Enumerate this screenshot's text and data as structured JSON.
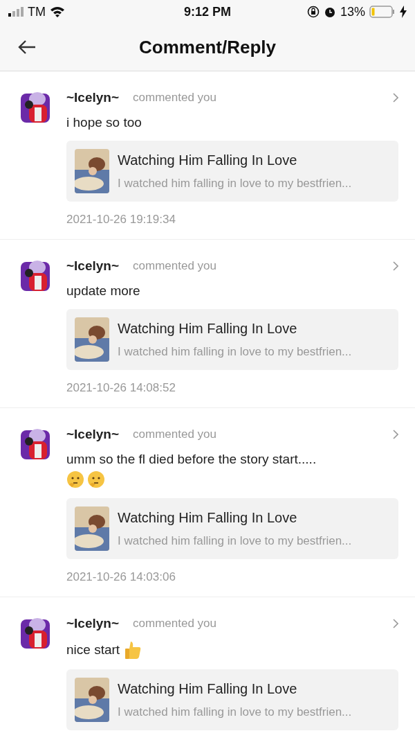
{
  "status_bar": {
    "carrier": "TM",
    "time": "9:12 PM",
    "battery": "13%"
  },
  "header": {
    "title": "Comment/Reply"
  },
  "notifications": [
    {
      "user": "~Icelyn~",
      "action": "commented you",
      "text": "i hope so too",
      "story": {
        "title": "Watching Him Falling In Love",
        "excerpt": "I watched him falling in love to my bestfrien..."
      },
      "date": "2021-10-26 19:19:34"
    },
    {
      "user": "~Icelyn~",
      "action": "commented you",
      "text": "update more",
      "story": {
        "title": "Watching Him Falling In Love",
        "excerpt": "I watched him falling in love to my bestfrien..."
      },
      "date": "2021-10-26 14:08:52"
    },
    {
      "user": "~Icelyn~",
      "action": "commented you",
      "text": "umm so the fl died before the story start.....",
      "emoji_line": [
        {
          "kind": "thinking"
        },
        {
          "kind": "thinking"
        }
      ],
      "story": {
        "title": "Watching Him Falling In Love",
        "excerpt": "I watched him falling in love to my bestfrien..."
      },
      "date": "2021-10-26 14:03:06"
    },
    {
      "user": "~Icelyn~",
      "action": "commented you",
      "text": "nice start",
      "trailing_emojis": [
        {
          "kind": "thumbs_up"
        }
      ],
      "story": {
        "title": "Watching Him Falling In Love",
        "excerpt": "I watched him falling in love to my bestfrien..."
      }
    }
  ]
}
